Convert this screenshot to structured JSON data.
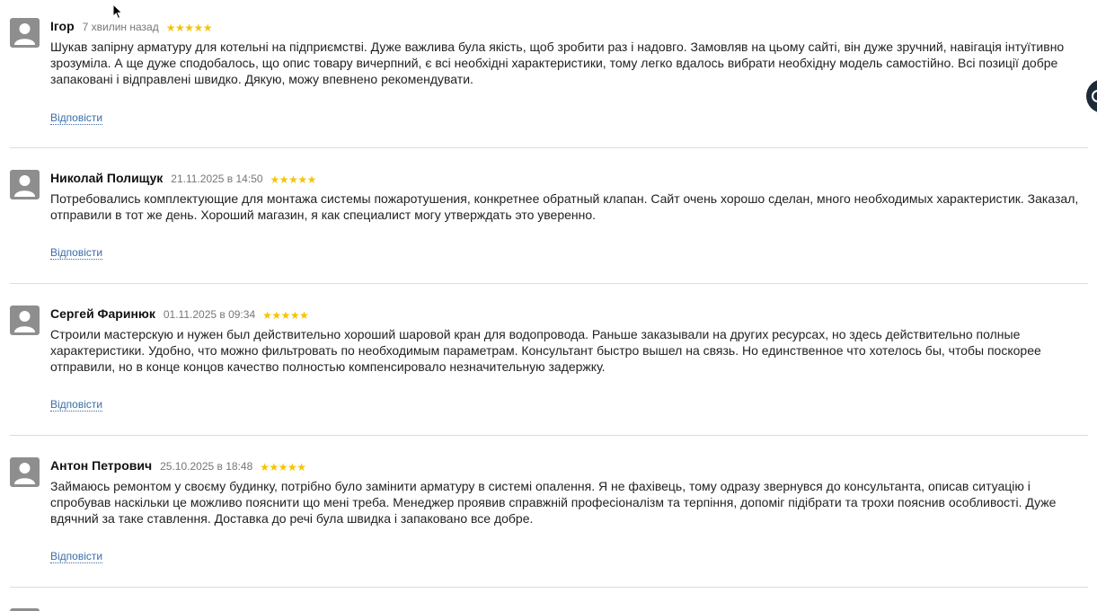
{
  "reply_label": "Відповісти",
  "star_color": "#f5c400",
  "link_color": "#3b6ea8",
  "reviews": [
    {
      "author": "Ігор",
      "date": "7 хвилин назад",
      "rating": 5,
      "stars": "★★★★★",
      "text": "Шукав запірну арматуру для котельні на підприємстві. Дуже важлива була якість, щоб зробити раз і надовго. Замовляв на цьому сайті, він дуже зручний, навігація інтуїтивно зрозуміла. А ще дуже сподобалось, що опис товару вичерпний, є всі необхідні характеристики, тому легко вдалось вибрати необхідну модель самостійно. Всі позиції добре запаковані і відправлені швидко. Дякую, можу впевнено рекомендувати."
    },
    {
      "author": "Николай Полищук",
      "date": "21.11.2025 в 14:50",
      "rating": 5,
      "stars": "★★★★★",
      "text": "Потребовались комплектующие для монтажа системы пожаротушения, конкретнее обратный клапан. Сайт очень хорошо сделан, много необходимых характеристик. Заказал, отправили в тот же день. Хороший магазин, я как специалист могу утверждать это уверенно."
    },
    {
      "author": "Сергей Фаринюк",
      "date": "01.11.2025 в 09:34",
      "rating": 5,
      "stars": "★★★★★",
      "text": "Строили мастерскую и нужен был действительно хороший шаровой кран для водопровода. Раньше заказывали на других ресурсах, но здесь действительно полные характеристики. Удобно, что можно фильтровать по необходимым параметрам. Консультант быстро вышел на связь. Но единственное что хотелось бы, чтобы поскорее отправили, но в конце концов качество полностью компенсировало незначительную задержку."
    },
    {
      "author": "Антон Петрович",
      "date": "25.10.2025 в 18:48",
      "rating": 5,
      "stars": "★★★★★",
      "text": "Займаюсь ремонтом у своєму будинку, потрібно було замінити арматуру в системі опалення. Я не фахівець, тому одразу звернувся до консультанта, описав ситуацію і спробував наскільки це можливо пояснити що мені треба. Менеджер проявив справжній професіоналізм та терпіння, допоміг підібрати та трохи пояснив особливості. Дуже вдячний за таке ставлення. Доставка до речі була швидка і запаковано все добре."
    }
  ]
}
